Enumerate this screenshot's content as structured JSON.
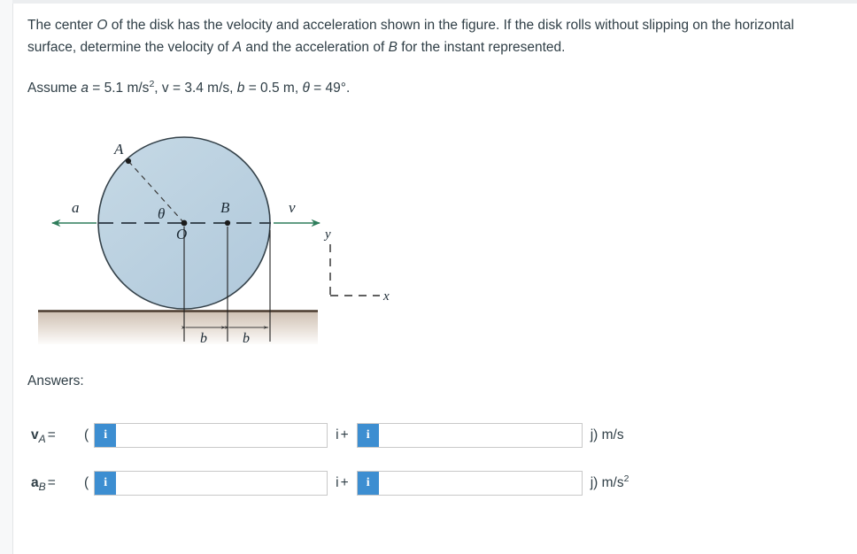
{
  "problem": {
    "statement_part1": "The center ",
    "statement_O": "O",
    "statement_part2": " of the disk has the velocity and acceleration shown in the figure. If the disk rolls without slipping on the horizontal surface, determine the velocity of ",
    "statement_A": "A",
    "statement_part3": " and the acceleration of ",
    "statement_B": "B",
    "statement_part4": " for the instant represented.",
    "assume_prefix": "Assume ",
    "assume_a_sym": "a",
    "assume_a_val": " = 5.1 m/s",
    "assume_a_exp": "2",
    "assume_v": ", v = 3.4 m/s, ",
    "assume_b_sym": "b",
    "assume_b_val": " = 0.5 m, ",
    "assume_theta_sym": "θ",
    "assume_theta_val": " = 49°."
  },
  "figure": {
    "label_A": "A",
    "label_B": "B",
    "label_O": "O",
    "label_theta": "θ",
    "label_a": "a",
    "label_v": "v",
    "label_b_left": "b",
    "label_b_right": "b",
    "axis_x": "x",
    "axis_y": "y",
    "disk_fill": "#b8d0e0",
    "disk_stroke": "#35424a",
    "vector_color": "#2e7d5b",
    "ground_top": "#5c4a3a",
    "centerline_color": "#2b3742"
  },
  "answers": {
    "heading": "Answers:",
    "rows": [
      {
        "symbol_main": "v",
        "symbol_sub": "A",
        "equals": "=",
        "open_paren": "(",
        "info_label": "i",
        "value_i": "",
        "placeholder_i": "",
        "unit_i": "i",
        "plus": "+",
        "value_j": "",
        "placeholder_j": "",
        "close_unit": "j) m/s",
        "exponent": ""
      },
      {
        "symbol_main": "a",
        "symbol_sub": "B",
        "equals": "=",
        "open_paren": "(",
        "info_label": "i",
        "value_i": "",
        "placeholder_i": "",
        "unit_i": "i",
        "plus": "+",
        "value_j": "",
        "placeholder_j": "",
        "close_unit": "j) m/s",
        "exponent": "2"
      }
    ]
  }
}
